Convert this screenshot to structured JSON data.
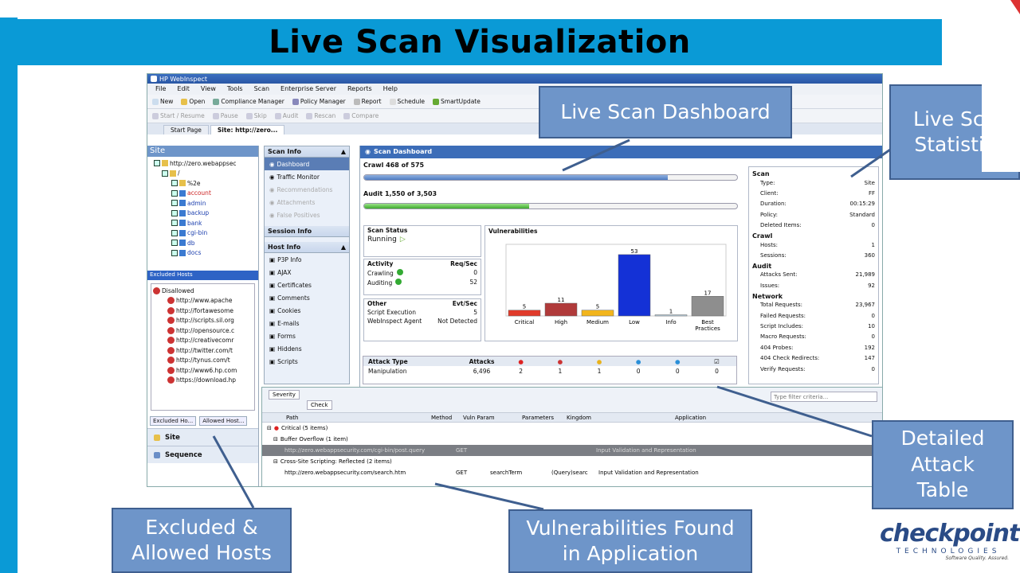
{
  "slide": {
    "title": "Live Scan Visualization"
  },
  "app": {
    "title": "HP WebInspect",
    "menu": [
      "File",
      "Edit",
      "View",
      "Tools",
      "Scan",
      "Enterprise Server",
      "Reports",
      "Help"
    ],
    "toolbar1": [
      "New",
      "Open",
      "Compliance Manager",
      "Policy Manager",
      "Report",
      "Schedule",
      "SmartUpdate"
    ],
    "toolbar2": [
      "Start / Resume",
      "Pause",
      "Skip",
      "Audit",
      "Rescan",
      "Compare"
    ],
    "tabs": [
      "Start Page",
      "Site: http://zero..."
    ],
    "site_panel": {
      "title": "Site",
      "tree": [
        "http://zero.webappsec",
        "/",
        "%2e",
        "account",
        "admin",
        "backup",
        "bank",
        "cgi-bin",
        "db",
        "docs"
      ]
    },
    "excluded": {
      "title": "Excluded Hosts",
      "group": "Disallowed",
      "hosts": [
        "http://www.apache",
        "http://fortawesome",
        "http://scripts.sil.org",
        "http://opensource.c",
        "http://creativecomr",
        "http://twitter.com/t",
        "http://tynus.com/t",
        "http://www6.hp.com",
        "https://download.hp"
      ],
      "tabs": [
        "Excluded Ho...",
        "Allowed Host..."
      ]
    },
    "nav_big": [
      "Site",
      "Sequence"
    ],
    "scan_info": {
      "title": "Scan Info",
      "items": [
        "Dashboard",
        "Traffic Monitor",
        "Recommendations",
        "Attachments",
        "False Positives"
      ],
      "session_title": "Session Info",
      "host_title": "Host Info",
      "host_items": [
        "P3P Info",
        "AJAX",
        "Certificates",
        "Comments",
        "Cookies",
        "E-mails",
        "Forms",
        "Hiddens",
        "Scripts"
      ]
    },
    "dashboard": {
      "title": "Scan Dashboard",
      "crawl_label": "Crawl  468 of 575",
      "crawl_progress": 0.814,
      "audit_label": "Audit  1,550 of 3,503",
      "audit_progress": 0.442,
      "status": {
        "title": "Scan Status",
        "value": "Running"
      },
      "activity": {
        "title": "Activity",
        "col": "Req/Sec",
        "rows": [
          [
            "Crawling",
            "0"
          ],
          [
            "Auditing",
            "52"
          ]
        ]
      },
      "other": {
        "title": "Other",
        "col": "Evt/Sec",
        "rows": [
          [
            "Script Execution",
            "5"
          ],
          [
            "WebInspect Agent",
            "Not Detected"
          ]
        ]
      }
    },
    "stats": {
      "sections": [
        {
          "title": "Scan",
          "rows": [
            [
              "Type:",
              "Site"
            ],
            [
              "Client:",
              "FF"
            ],
            [
              "Duration:",
              "00:15:29"
            ],
            [
              "Policy:",
              "Standard"
            ],
            [
              "Deleted Items:",
              "0"
            ]
          ]
        },
        {
          "title": "Crawl",
          "rows": [
            [
              "Hosts:",
              "1"
            ],
            [
              "Sessions:",
              "360"
            ]
          ]
        },
        {
          "title": "Audit",
          "rows": [
            [
              "Attacks Sent:",
              "21,989"
            ],
            [
              "Issues:",
              "92"
            ]
          ]
        },
        {
          "title": "Network",
          "rows": [
            [
              "Total Requests:",
              "23,967"
            ],
            [
              "Failed Requests:",
              "0"
            ],
            [
              "Script Includes:",
              "10"
            ],
            [
              "Macro Requests:",
              "0"
            ],
            [
              "404 Probes:",
              "192"
            ],
            [
              "404 Check Redirects:",
              "147"
            ],
            [
              "Verify Requests:",
              "0"
            ]
          ]
        }
      ]
    },
    "attack_table": {
      "headers": [
        "Attack Type",
        "Attacks",
        "",
        "",
        "",
        "",
        "",
        ""
      ],
      "rows": [
        [
          "Manipulation",
          "6,496",
          "2",
          "1",
          "1",
          "0",
          "0",
          "0"
        ]
      ]
    },
    "vuln_grid": {
      "filter_placeholder": "Type filter criteria...",
      "group_chips": [
        "Severity",
        "Check"
      ],
      "headers": [
        "Path",
        "Method",
        "Vuln Param",
        "Parameters",
        "Kingdom",
        "Application"
      ],
      "rows": [
        {
          "text": "Critical (5 items)"
        },
        {
          "text": "Buffer Overflow (1 item)"
        },
        {
          "text": "http://zero.webappsecurity.com/cgi-bin/post.query",
          "method": "GET",
          "kingdom": "Input Validation and Representation"
        },
        {
          "text": "Cross-Site Scripting: Reflected (2 items)"
        },
        {
          "text": "http://zero.webappsecurity.com/search.htm",
          "method": "GET",
          "param": "searchTerm",
          "params": "(Query)searc",
          "kingdom": "Input Validation and Representation"
        }
      ]
    }
  },
  "chart_data": {
    "type": "bar",
    "title": "Vulnerabilities",
    "categories": [
      "Critical",
      "High",
      "Medium",
      "Low",
      "Info",
      "Best Practices"
    ],
    "values": [
      5,
      11,
      5,
      53,
      1,
      17
    ],
    "colors": [
      "#e03a2a",
      "#b03a3a",
      "#f2b51c",
      "#1431d6",
      "#b8d0de",
      "#8e8e8e"
    ],
    "ylim": [
      0,
      55
    ]
  },
  "callouts": {
    "dashboard": "Live Scan Dashboard",
    "stats_line1": "Live Sca",
    "stats_line2": "Statistic",
    "attack_l1": "Detailed",
    "attack_l2": "Attack",
    "attack_l3": "Table",
    "hosts_l1": "Excluded &",
    "hosts_l2": "Allowed Hosts",
    "vuln_l1": "Vulnerabilities Found",
    "vuln_l2": "in Application"
  },
  "logo": {
    "name": "checkpoint",
    "line2": "TECHNOLOGIES",
    "tag": "Software Quality. Assured."
  }
}
